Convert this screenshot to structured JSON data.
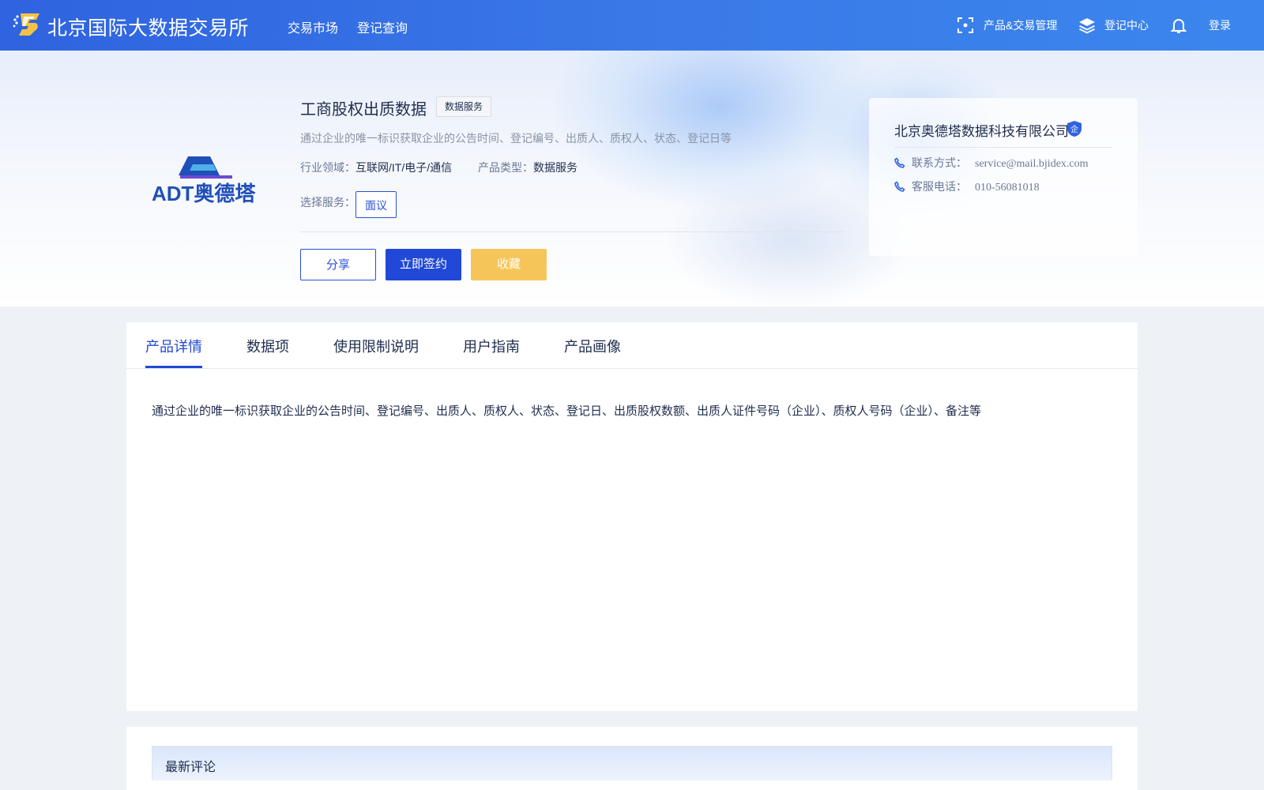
{
  "header": {
    "brand": "北京国际大数据交易所",
    "nav": [
      "交易市场",
      "登记查询"
    ],
    "right": {
      "product_mgmt": "产品&交易管理",
      "registry_center": "登记中心",
      "login": "登录"
    },
    "icons": [
      "logo-icon",
      "scan-icon",
      "layers-icon",
      "bell-icon"
    ]
  },
  "product": {
    "logo_text": "ADT奥德塔",
    "title": "工商股权出质数据",
    "type_badge": "数据服务",
    "description": "通过企业的唯一标识获取企业的公告时间、登记编号、出质人、质权人、状态、登记日等",
    "industry_label": "行业领域：",
    "industry_value": "互联网/IT/电子/通信",
    "type_label": "产品类型：",
    "type_value": "数据服务",
    "service_label": "选择服务：",
    "service_option": "面议",
    "buttons": {
      "share": "分享",
      "sign": "立即签约",
      "favorite": "收藏"
    }
  },
  "vendor": {
    "name": "北京奥德塔数据科技有限公司",
    "badge": "企",
    "contact_label": "联系方式：",
    "contact_value": "service@mail.bjidex.com",
    "phone_label": "客服电话：",
    "phone_value": "010-56081018"
  },
  "tabs": {
    "items": [
      "产品详情",
      "数据项",
      "使用限制说明",
      "用户指南",
      "产品画像"
    ],
    "active": "产品详情"
  },
  "detail": {
    "text": "通过企业的唯一标识获取企业的公告时间、登记编号、出质人、质权人、状态、登记日、出质股权数额、出质人证件号码（企业）、质权人号码（企业）、备注等"
  },
  "comments": {
    "title": "最新评论"
  },
  "colors": {
    "primary": "#2148d6",
    "header_gradient_start": "#2f63df",
    "header_gradient_end": "#3b86ee",
    "favorite": "#f6c55a",
    "text_dark": "#1f2d4d",
    "text_muted": "#6b7896"
  }
}
